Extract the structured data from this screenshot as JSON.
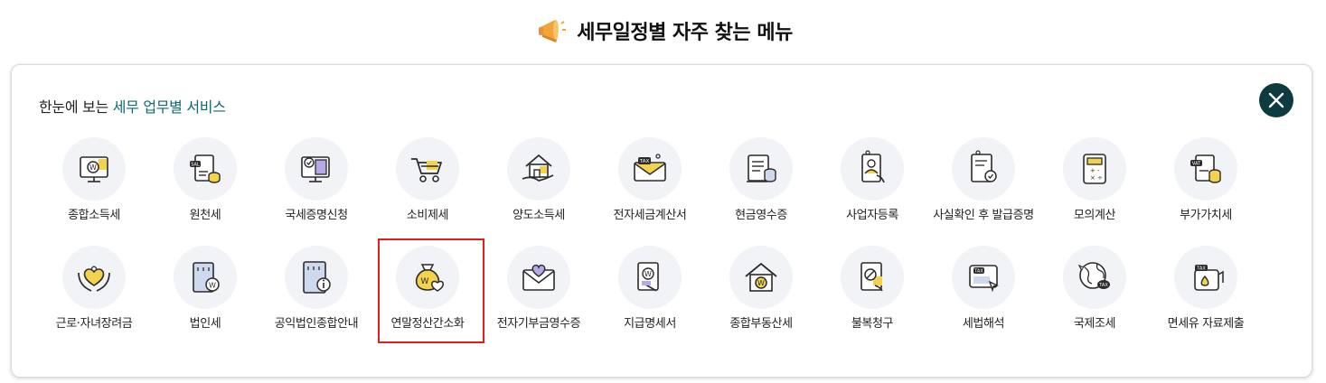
{
  "page_title": "세무일정별 자주 찾는 메뉴",
  "panel": {
    "heading_prefix": "한눈에 보는 ",
    "heading_accent": "세무 업무별 서비스",
    "accent_color": "#0b6a73",
    "close_button_color": "#0e3b3f"
  },
  "highlight_color": "#e01e1e",
  "rows": [
    [
      {
        "label": "종합소득세",
        "icon": "monitor-won-icon"
      },
      {
        "label": "원천세",
        "icon": "sal-coins-icon"
      },
      {
        "label": "국세증명신청",
        "icon": "monitor-document-icon"
      },
      {
        "label": "소비제세",
        "icon": "shopping-cart-icon"
      },
      {
        "label": "양도소득세",
        "icon": "house-hand-icon"
      },
      {
        "label": "전자세금계산서",
        "icon": "tax-envelope-icon"
      },
      {
        "label": "현금영수증",
        "icon": "receipt-coins-icon"
      },
      {
        "label": "사업자등록",
        "icon": "id-card-hand-icon"
      },
      {
        "label": "사실확인 후 발급증명",
        "icon": "certificate-icon"
      },
      {
        "label": "모의계산",
        "icon": "calculator-icon"
      },
      {
        "label": "부가가치세",
        "icon": "vat-coins-icon"
      }
    ],
    [
      {
        "label": "근로·자녀장려금",
        "icon": "hands-heart-icon"
      },
      {
        "label": "법인세",
        "icon": "building-won-icon"
      },
      {
        "label": "공익법인종합안내",
        "icon": "building-info-icon"
      },
      {
        "label": "연말정산간소화",
        "icon": "money-bag-icon"
      },
      {
        "label": "전자기부금영수증",
        "icon": "heart-envelope-icon"
      },
      {
        "label": "지급명세서",
        "icon": "document-hand-icon"
      },
      {
        "label": "종합부동산세",
        "icon": "house-won-icon"
      },
      {
        "label": "불복청구",
        "icon": "document-stop-icon"
      },
      {
        "label": "세법해석",
        "icon": "tax-window-icon"
      },
      {
        "label": "국제조세",
        "icon": "globe-tax-icon"
      },
      {
        "label": "면세유 자료제출",
        "icon": "oil-can-icon"
      }
    ]
  ]
}
